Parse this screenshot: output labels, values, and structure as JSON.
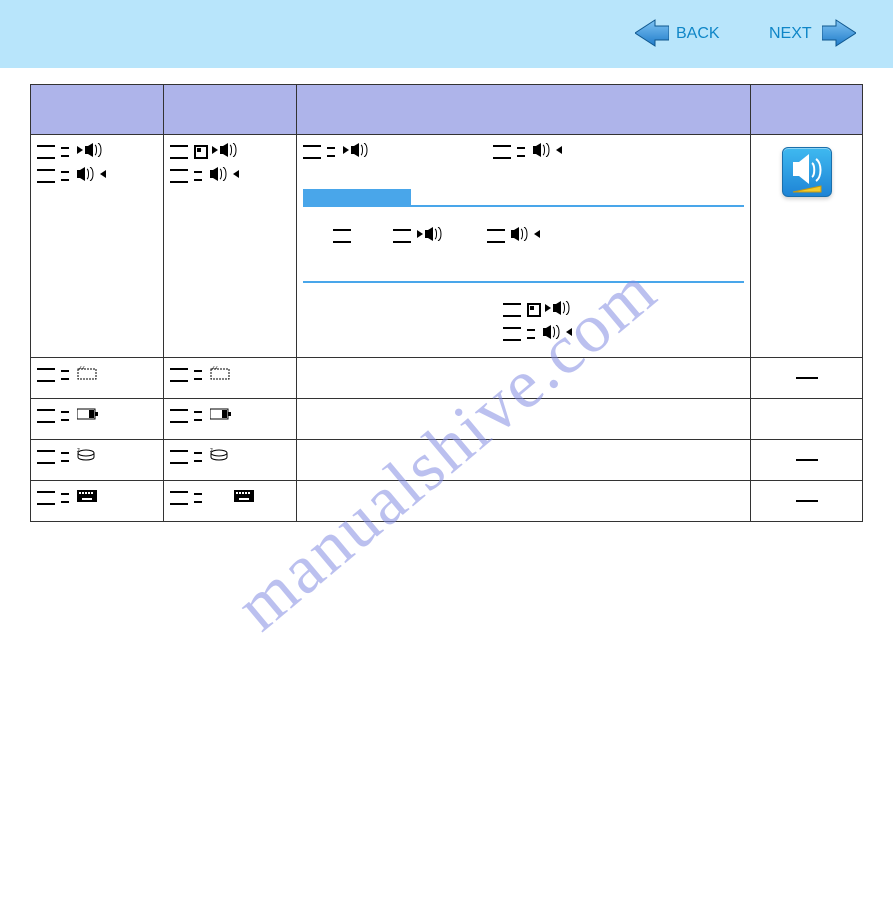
{
  "nav": {
    "back": "BACK",
    "next": "NEXT"
  },
  "watermark": "manualshive.com",
  "table": {
    "headers": [
      "",
      "",
      "",
      ""
    ],
    "rows": [
      {
        "c4_dash": false
      },
      {
        "c4_dash": true
      },
      {
        "c4_dash": false
      },
      {
        "c4_dash": true
      },
      {
        "c4_dash": true
      }
    ]
  }
}
